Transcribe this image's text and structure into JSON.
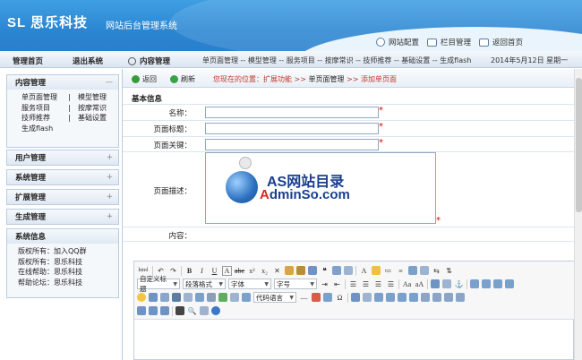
{
  "header": {
    "logo_text": "SL 思乐科技",
    "subtitle": "网站后台管理系统",
    "links": [
      {
        "label": "网站配置",
        "icon": "gear-icon"
      },
      {
        "label": "栏目管理",
        "icon": "window-icon"
      },
      {
        "label": "返回首页",
        "icon": "envelope-icon"
      }
    ]
  },
  "nav": {
    "home": "管理首页",
    "exit": "退出系统",
    "content_title": "内容管理",
    "top_links": "单页面管理 -- 模型管理 -- 服务项目 -- 按摩常识 -- 技师推荐 -- 基础设置 -- 生成flash",
    "date": "2014年5月12日 星期一"
  },
  "sidebar": {
    "content_panel": {
      "title": "内容管理",
      "toggle": "—",
      "rows": [
        [
          "单页面管理",
          "|",
          "模型管理"
        ],
        [
          "服务项目",
          "|",
          "按摩常识"
        ],
        [
          "技师推荐",
          "|",
          "基础设置"
        ]
      ],
      "last": "生成flash"
    },
    "collapsed": [
      {
        "title": "用户管理",
        "toggle": "+"
      },
      {
        "title": "系统管理",
        "toggle": "+"
      },
      {
        "title": "扩展管理",
        "toggle": "+"
      },
      {
        "title": "生成管理",
        "toggle": "+"
      }
    ],
    "info_panel": {
      "title": "系统信息",
      "lines": [
        "版权所有：加入QQ群",
        "版权所有：思乐科技",
        "在线帮助：思乐科技",
        "帮助论坛：思乐科技"
      ]
    }
  },
  "action_bar": {
    "back": "返回",
    "refresh": "刷新",
    "location_prefix": "您现在的位置：扩展功能 >>",
    "location_current": "单页面管理",
    "location_suffix": ">> 添加单页面"
  },
  "form": {
    "section_title": "基本信息",
    "fields": [
      {
        "label": "名称：",
        "required": "*"
      },
      {
        "label": "页面标题：",
        "required": "*"
      },
      {
        "label": "页面关键：",
        "required": "*"
      }
    ],
    "description_label": "页面描述：",
    "content_label": "内容："
  },
  "watermark": {
    "title": "AS网站目录",
    "url_red": "A",
    "url_rest": "dminSo.com"
  },
  "editor": {
    "html_label": "html",
    "heading_select": "自定义标题",
    "paragraph_select": "段落格式",
    "font_select": "字体",
    "size_select": "字号",
    "code_select": "代码语言"
  },
  "colors": {
    "header_blue": "#2a86d2",
    "required_red": "#d00000",
    "location_red": "#c0392b",
    "watermark_blue": "#1a3f8f"
  }
}
